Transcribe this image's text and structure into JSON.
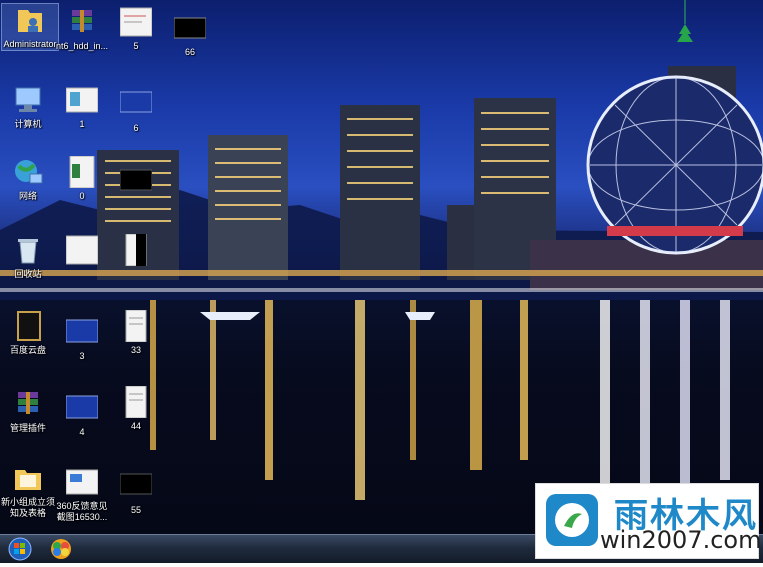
{
  "desktop": {
    "icons": [
      {
        "label": "Administrator",
        "icon": "user-folder-icon"
      },
      {
        "label": "nt6_hdd_in...",
        "icon": "winrar-archive-icon"
      },
      {
        "label": "5",
        "icon": "image-thumbnail-icon"
      },
      {
        "label": "66",
        "icon": "image-thumbnail-icon"
      },
      {
        "label": "计算机",
        "icon": "computer-icon"
      },
      {
        "label": "1",
        "icon": "image-thumbnail-icon"
      },
      {
        "label": "6",
        "icon": "image-thumbnail-icon"
      },
      {
        "label": "网络",
        "icon": "network-icon"
      },
      {
        "label": "0",
        "icon": "image-thumbnail-icon"
      },
      {
        "label": "",
        "icon": "image-thumbnail-icon"
      },
      {
        "label": "回收站",
        "icon": "recycle-bin-icon"
      },
      {
        "label": "",
        "icon": "image-thumbnail-icon"
      },
      {
        "label": "",
        "icon": "image-thumbnail-icon"
      },
      {
        "label": "百度云盘",
        "icon": "app-icon"
      },
      {
        "label": "3",
        "icon": "image-thumbnail-icon"
      },
      {
        "label": "33",
        "icon": "image-thumbnail-icon"
      },
      {
        "label": "管理插件",
        "icon": "winrar-archive-icon"
      },
      {
        "label": "4",
        "icon": "image-thumbnail-icon"
      },
      {
        "label": "44",
        "icon": "image-thumbnail-icon"
      },
      {
        "label": "新小组成立须知及表格",
        "icon": "folder-icon"
      },
      {
        "label": "360反馈意见截图16530...",
        "icon": "image-thumbnail-icon"
      },
      {
        "label": "55",
        "icon": "image-thumbnail-icon"
      }
    ]
  },
  "taskbar": {
    "start": "start-orb-icon",
    "pinned_app": "app-launcher-icon"
  },
  "watermark": {
    "title": "雨林木风",
    "url": "win2007.com"
  }
}
